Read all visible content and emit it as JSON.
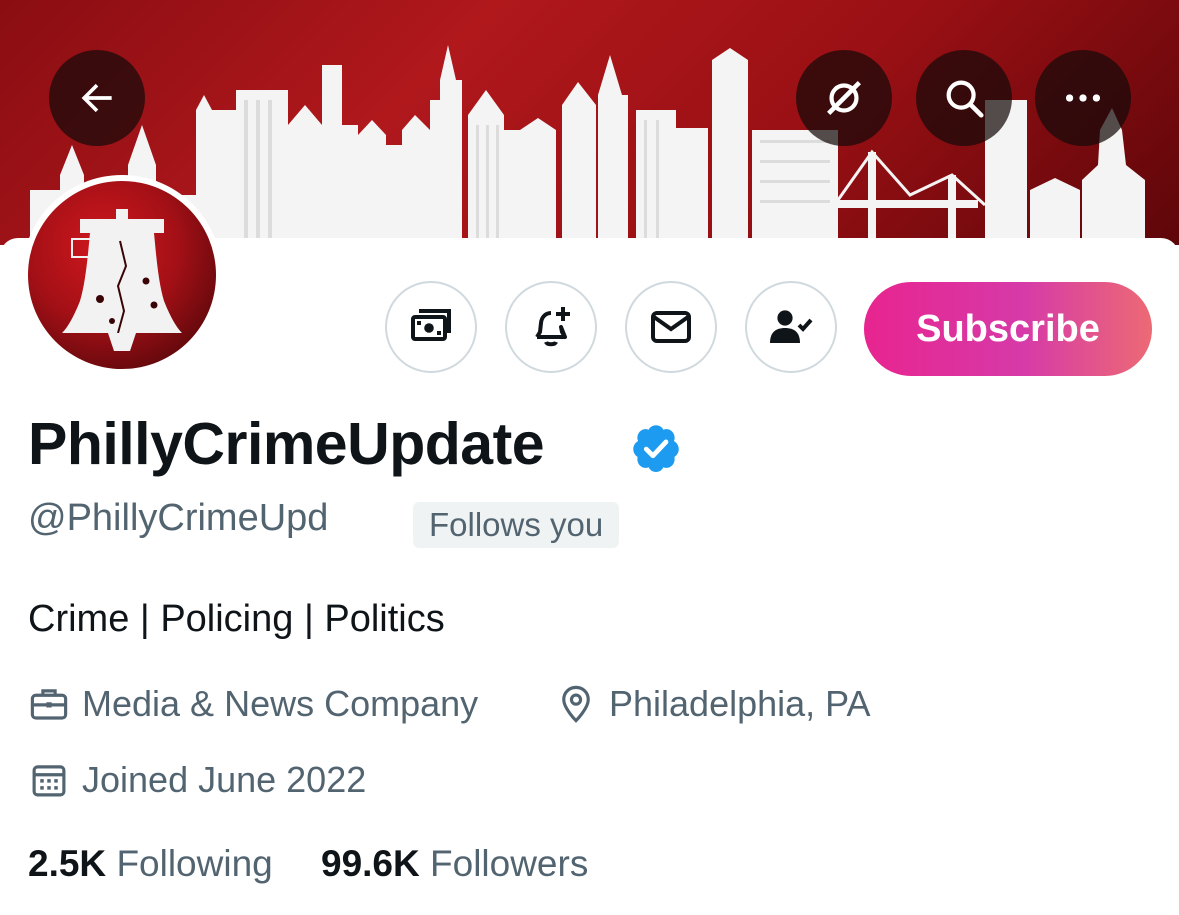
{
  "header": {
    "back_icon": "arrow-left-icon",
    "grok_icon": "grok-icon",
    "search_icon": "search-icon",
    "more_icon": "more-horizontal-icon",
    "banner_color": "#a31016"
  },
  "actions": {
    "tip_icon": "money-icon",
    "notify_icon": "bell-plus-icon",
    "message_icon": "envelope-icon",
    "following_icon": "person-check-icon",
    "subscribe_label": "Subscribe",
    "subscribe_colors": [
      "#e8248f",
      "#ec6a74"
    ]
  },
  "profile": {
    "display_name": "PhillyCrimeUpdate",
    "verified_color": "#1d9bf0",
    "handle": "@PhillyCrimeUpd",
    "follows_you": "Follows you",
    "bio": "Crime | Policing | Politics",
    "category": "Media & News Company",
    "location": "Philadelphia, PA",
    "joined": "Joined June 2022"
  },
  "stats": {
    "following_count": "2.5K",
    "following_label": "Following",
    "followers_count": "99.6K",
    "followers_label": "Followers"
  }
}
